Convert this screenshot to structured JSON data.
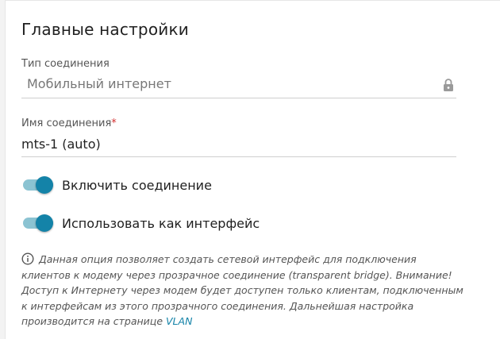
{
  "section": {
    "title": "Главные настройки"
  },
  "connection_type": {
    "label": "Тип соединения",
    "value": "Мобильный интернет",
    "icon": "lock-icon"
  },
  "connection_name": {
    "label": "Имя соединения",
    "required_mark": "*",
    "value": "mts-1 (auto)"
  },
  "toggles": [
    {
      "label": "Включить соединение",
      "state": "on"
    },
    {
      "label": "Использовать как интерфейс",
      "state": "on"
    }
  ],
  "note": {
    "icon": "info-icon",
    "text": "Данная опция позволяет создать сетевой интерфейс для подключения клиентов к модему через прозрачное соединение (transparent bridge). Внимание! Доступ к Интернету через модем будет доступен только клиентам, подключенным к интерфейсам из этого прозрачного соединения. Дальнейшая настройка производится на странице",
    "link": "VLAN"
  },
  "colors": {
    "accent": "#1483a8",
    "toggle_track": "#8bc3d2",
    "required": "#d32f2f"
  }
}
